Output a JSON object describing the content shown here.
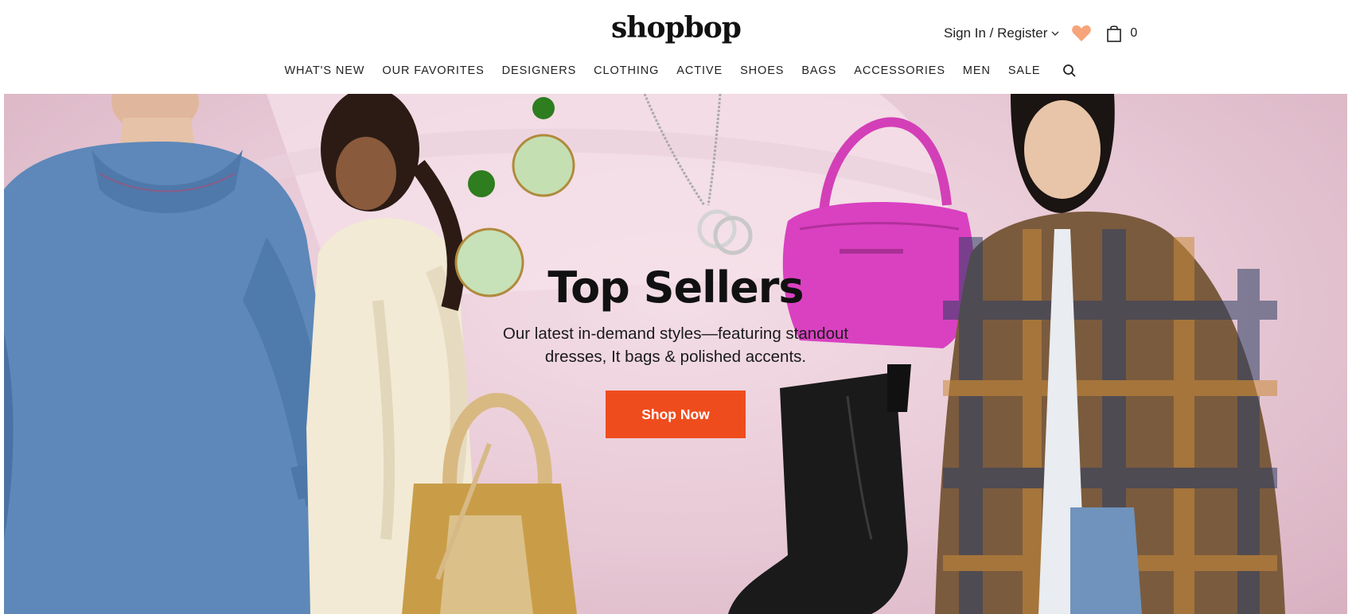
{
  "brand": {
    "logo_text": "shopbop"
  },
  "account": {
    "signin_label": "Sign In / Register",
    "bag_count": "0"
  },
  "nav": {
    "items": [
      {
        "label": "WHAT'S NEW"
      },
      {
        "label": "OUR FAVORITES"
      },
      {
        "label": "DESIGNERS"
      },
      {
        "label": "CLOTHING"
      },
      {
        "label": "ACTIVE"
      },
      {
        "label": "SHOES"
      },
      {
        "label": "BAGS"
      },
      {
        "label": "ACCESSORIES"
      },
      {
        "label": "MEN"
      },
      {
        "label": "SALE"
      }
    ]
  },
  "icons": {
    "wishlist": "heart-icon",
    "cart": "shopping-bag-icon",
    "search": "search-icon",
    "dropdown": "chevron-down-icon"
  },
  "hero": {
    "title": "Top Sellers",
    "subtitle": "Our latest in-demand styles—featuring standout dresses, It bags & polished accents.",
    "cta_label": "Shop Now"
  },
  "colors": {
    "accent": "#ef4c1e",
    "heart": "#f7a47a",
    "hero_bg": "#e7c8d5"
  }
}
